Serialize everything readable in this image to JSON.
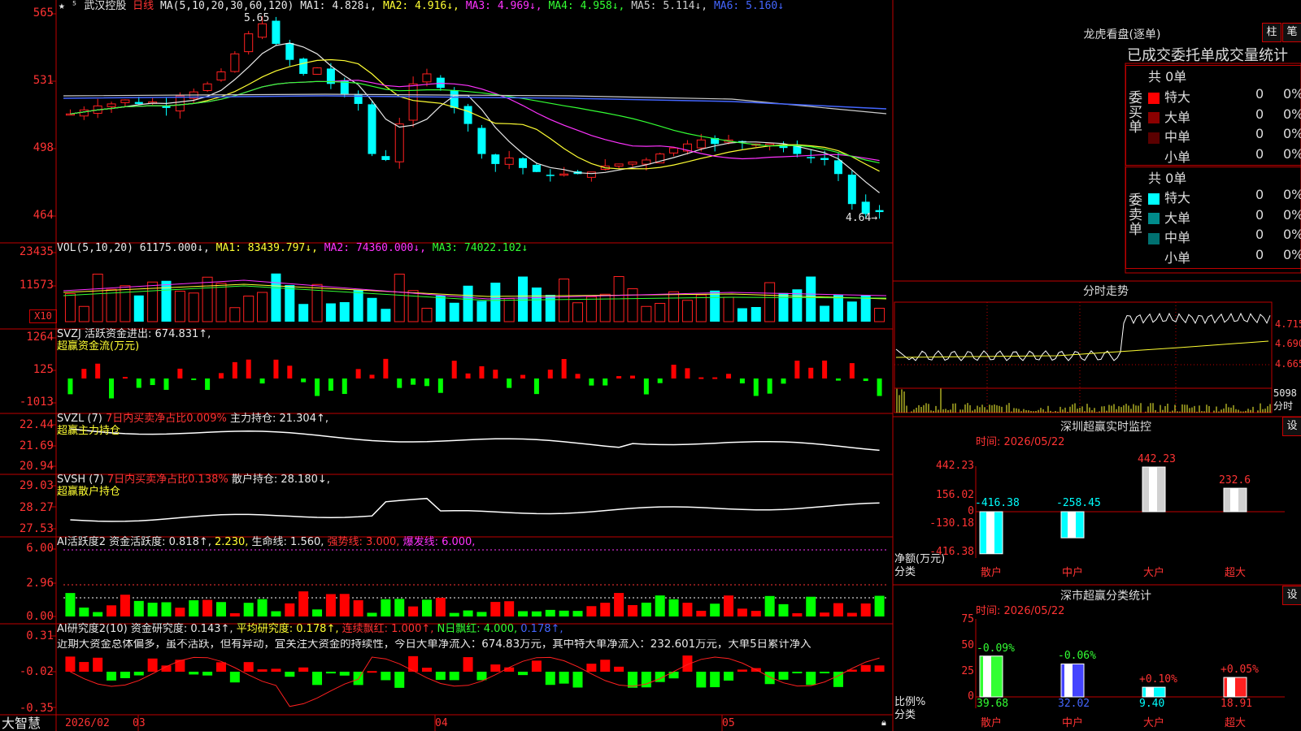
{
  "stock": {
    "name": "武汉控股",
    "period": "日线",
    "ma_header": "MA(5,10,20,30,60,120)",
    "ma_values": [
      {
        "label": "MA1: 4.828↓,",
        "color": "#e8e8e8"
      },
      {
        "label": "MA2: 4.916↓,",
        "color": "#ffff33"
      },
      {
        "label": "MA3: 4.969↓,",
        "color": "#ff33ff"
      },
      {
        "label": "MA4: 4.958↓,",
        "color": "#33ff33"
      },
      {
        "label": "MA5: 5.114↓,",
        "color": "#cccccc"
      },
      {
        "label": "MA6: 5.160↓",
        "color": "#4466ff"
      }
    ],
    "price_ticks": [
      "565",
      "531",
      "498",
      "464"
    ],
    "high_marker": "5.65",
    "low_marker": "4.64→"
  },
  "vol": {
    "header": "VOL(5,10,20)",
    "value": "61175.000↓,",
    "ma1": "MA1: 83439.797↓,",
    "ma2": "MA2: 74360.000↓,",
    "ma3": "MA3: 74022.102↓",
    "ticks": [
      "23435",
      "11573"
    ],
    "unit_badge": "X10"
  },
  "svzj": {
    "header": "SVZJ  活跃资金进出: 674.831↑,",
    "sub": "超赢资金流(万元)",
    "ticks": [
      "1264",
      "125",
      "-1013"
    ]
  },
  "svzl": {
    "header_a": "SVZL (7)",
    "header_b": "7日内买卖净占比0.009%",
    "header_c": "主力持仓: 21.304↑,",
    "sub": "超赢主力持仓",
    "ticks": [
      "22.44",
      "21.69",
      "20.94"
    ]
  },
  "svsh": {
    "header_a": "SVSH (7)",
    "header_b": "7日内买卖净占比0.138%",
    "header_c": "散户持仓: 28.180↓,",
    "sub": "超赢散户持仓",
    "ticks": [
      "29.03",
      "28.27",
      "27.53"
    ]
  },
  "ai_active": {
    "header_a": "AI活跃度2 资金活跃度: 0.818↑,",
    "header_b": "2.230,",
    "header_c": "生命线: 1.560,",
    "header_d": "强势线: 3.000,",
    "header_e": "爆发线: 6.000,",
    "ticks": [
      "6.00",
      "2.96",
      "0.00"
    ]
  },
  "ai_research": {
    "header_a": "AI研究度2(10) 资金研究度: 0.143↑,",
    "header_b": "平均研究度: 0.178↑,",
    "header_c": "连续飘红: 1.000↑,",
    "header_d": "N日飘红: 4.000,",
    "header_e": "0.178↑,",
    "commentary": "近期大资金总体偏多，虽不活跃，但有异动，宜关注大资金的持续性，今日大单净流入：674.83万元，其中特大单净流入：232.601万元，大单5日累计净入",
    "ticks": [
      "0.31",
      "-0.02",
      "-0.35"
    ]
  },
  "bottom": {
    "brand": "大智慧",
    "dates": [
      "2026/02",
      "03",
      "04",
      "05"
    ]
  },
  "dragon": {
    "title": "龙虎看盘(逐单)",
    "btn_bar": "柱",
    "btn_pen": "笔",
    "tabs": "已成交委托单成交量统计",
    "buy_label": "委买单",
    "sell_label": "委卖单",
    "buy_total": "共 0单",
    "sell_total": "共 0单",
    "buy_rows": [
      {
        "label": "特大",
        "value": "0",
        "pct": "0%",
        "color": "#ff0000"
      },
      {
        "label": "大单",
        "value": "0",
        "pct": "0%",
        "color": "#8b0000"
      },
      {
        "label": "中单",
        "value": "0",
        "pct": "0%",
        "color": "#5a0000"
      },
      {
        "label": "小单",
        "value": "0",
        "pct": "0%",
        "color": "#000000"
      }
    ],
    "sell_rows": [
      {
        "label": "特大",
        "value": "0",
        "pct": "0%",
        "color": "#00ffff"
      },
      {
        "label": "大单",
        "value": "0",
        "pct": "0%",
        "color": "#008b8b"
      },
      {
        "label": "中单",
        "value": "0",
        "pct": "0%",
        "color": "#007070"
      },
      {
        "label": "小单",
        "value": "0",
        "pct": "0%",
        "color": "#000000"
      }
    ]
  },
  "intraday": {
    "title": "分时走势",
    "ticks": [
      "4.715",
      "4.690",
      "4.665"
    ],
    "vol_tick": "5098",
    "vol_label": "分时"
  },
  "monitor": {
    "title": "深圳超赢实时监控",
    "btn": "设",
    "time": "时间: 2026/05/22",
    "ticks": [
      "442.23",
      "156.02",
      "0",
      "-130.18",
      "-416.38"
    ],
    "ylabel": "净额(万元)",
    "xlabel": "分类",
    "bars": [
      {
        "label": "散户",
        "value": -416.38,
        "text": "-416.38"
      },
      {
        "label": "中户",
        "value": -258.45,
        "text": "-258.45"
      },
      {
        "label": "大户",
        "value": 442.23,
        "text": "442.23"
      },
      {
        "label": "超大",
        "value": 232.6,
        "text": "232.6"
      }
    ]
  },
  "classify": {
    "title": "深市超赢分类统计",
    "btn": "设",
    "time": "时间: 2026/05/22",
    "ticks": [
      "75",
      "50",
      "25",
      "0"
    ],
    "ylabel": "比例%",
    "xlabel": "分类",
    "bars": [
      {
        "label": "散户",
        "value": 39.68,
        "text": "39.68",
        "change": "-0.09%"
      },
      {
        "label": "中户",
        "value": 32.02,
        "text": "32.02",
        "change": "-0.06%"
      },
      {
        "label": "大户",
        "value": 9.4,
        "text": "9.40",
        "change": "+0.10%"
      },
      {
        "label": "超大",
        "value": 18.91,
        "text": "18.91",
        "change": "+0.05%"
      }
    ]
  },
  "colors": {
    "up": "#ff2020",
    "down": "#00ffff",
    "grid": "#c00000",
    "pos_bar": "#ff0000",
    "neg_bar": "#00ff00"
  }
}
